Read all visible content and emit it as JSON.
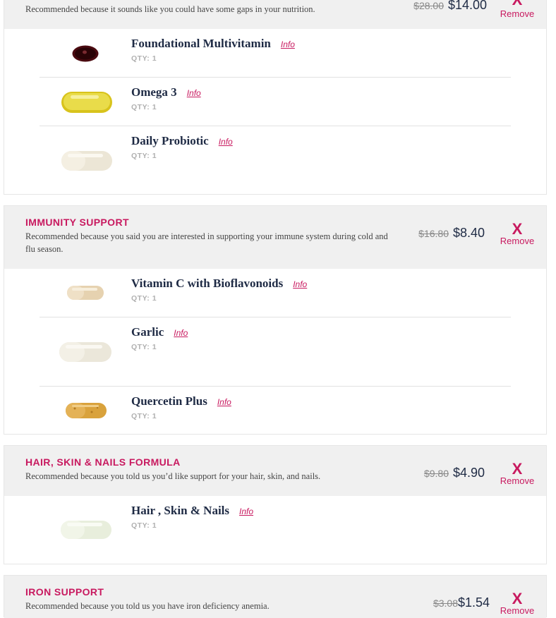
{
  "packs": [
    {
      "title": "",
      "reason": "Recommended because it sounds like you could have some gaps in your nutrition.",
      "price_old": "$28.00",
      "price_new": "$14.00",
      "remove_x": "X",
      "remove_label": "Remove",
      "items": [
        {
          "name": "Foundational Multivitamin",
          "info": "Info",
          "qty": "QTY: 1",
          "pill": "dark-red-softgel-icon"
        },
        {
          "name": "Omega 3",
          "info": "Info",
          "qty": "QTY: 1",
          "pill": "yellow-softgel-icon"
        },
        {
          "name": "Daily Probiotic",
          "info": "Info",
          "qty": "QTY: 1",
          "pill": "white-capsule-icon"
        }
      ]
    },
    {
      "title": "IMMUNITY SUPPORT",
      "reason": "Recommended because you said you are interested in supporting your immune system during cold and flu season.",
      "price_old": "$16.80",
      "price_new": "$8.40",
      "remove_x": "X",
      "remove_label": "Remove",
      "items": [
        {
          "name": "Vitamin C with Bioflavonoids",
          "info": "Info",
          "qty": "QTY: 1",
          "pill": "beige-capsule-icon"
        },
        {
          "name": "Garlic",
          "info": "Info",
          "qty": "QTY: 1",
          "pill": "white-capsule-icon"
        },
        {
          "name": "Quercetin Plus",
          "info": "Info",
          "qty": "QTY: 1",
          "pill": "orange-capsule-icon"
        }
      ]
    },
    {
      "title": "HAIR, SKIN & NAILS FORMULA",
      "reason": "Recommended because you told us you’d like support for your hair, skin, and nails.",
      "price_old": "$9.80",
      "price_new": "$4.90",
      "remove_x": "X",
      "remove_label": "Remove",
      "items": [
        {
          "name": "Hair , Skin & Nails",
          "info": "Info",
          "qty": "QTY: 1",
          "pill": "white-capsule-icon"
        }
      ]
    },
    {
      "title": "IRON SUPPORT",
      "reason": "Recommended because you told us you have iron deficiency anemia.",
      "price_old": "$3.08",
      "price_new": "$1.54",
      "remove_x": "X",
      "remove_label": "Remove",
      "items": []
    }
  ],
  "colors": {
    "accent": "#c8195f",
    "heading": "#1e2a44",
    "header_bg": "#f0f0f0",
    "qty": "#b0b0b0"
  }
}
